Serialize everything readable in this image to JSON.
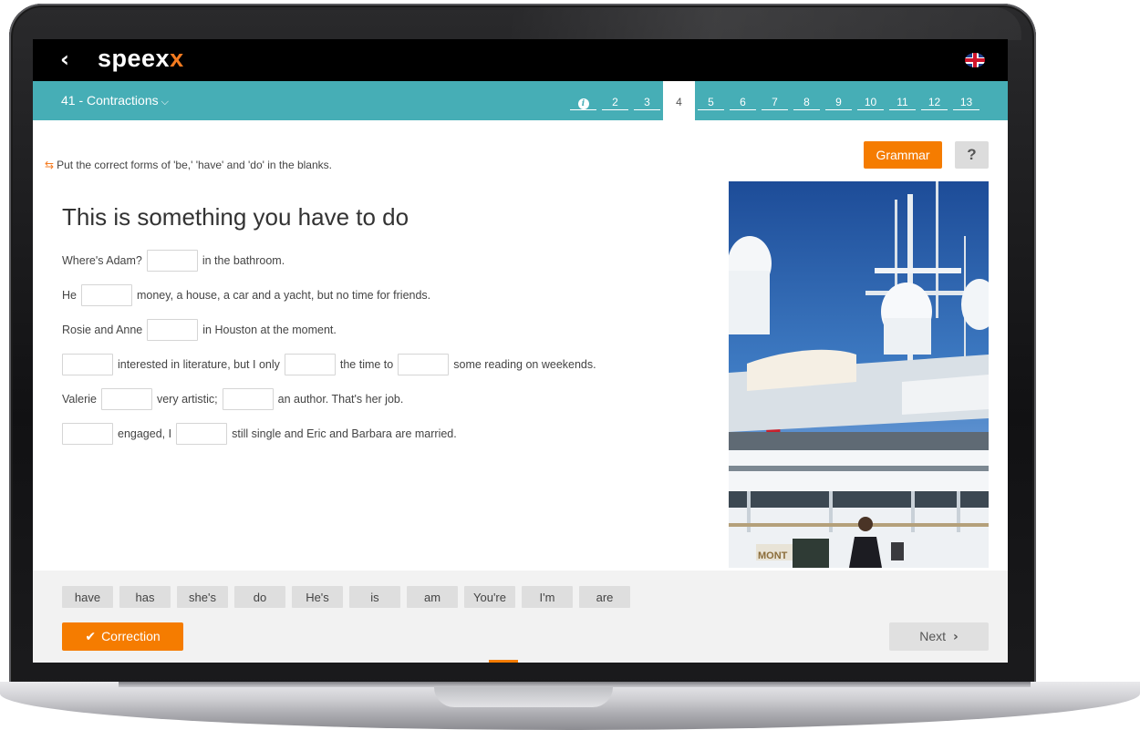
{
  "header": {
    "brand_main": "speex",
    "brand_accent": "x",
    "back_icon": "chevron-left-icon",
    "language_icon": "uk-flag-icon"
  },
  "lesson": {
    "title": "41 - Contractions",
    "steps": [
      "2",
      "3",
      "4",
      "5",
      "6",
      "7",
      "8",
      "9",
      "10",
      "11",
      "12",
      "13"
    ],
    "active_step": "4",
    "info_icon": "info-icon"
  },
  "exercise": {
    "instruction": "Put the correct forms of 'be,' 'have' and 'do' in the blanks.",
    "title": "This is something you have to do",
    "grammar_label": "Grammar",
    "help_label": "?",
    "lines": [
      [
        "Where's Adam?",
        null,
        "in the bathroom."
      ],
      [
        "He",
        null,
        "money, a house, a car and a yacht, but no time for friends."
      ],
      [
        "Rosie and Anne",
        null,
        "in Houston at the moment."
      ],
      [
        null,
        "interested in literature, but I only",
        null,
        "the time to",
        null,
        "some reading on weekends."
      ],
      [
        "Valerie",
        null,
        "very artistic;",
        null,
        "an author. That's her job."
      ],
      [
        null,
        "engaged, I",
        null,
        "still single and Eric and Barbara are married."
      ]
    ],
    "photo_sign": "MONT"
  },
  "word_bank": [
    "have",
    "has",
    "she's",
    "do",
    "He's",
    "is",
    "am",
    "You're",
    "I'm",
    "are"
  ],
  "footer": {
    "correction_label": "Correction",
    "next_label": "Next"
  },
  "colors": {
    "accent": "#f57c00",
    "teal": "#46aeb6",
    "topbar": "#000000"
  }
}
